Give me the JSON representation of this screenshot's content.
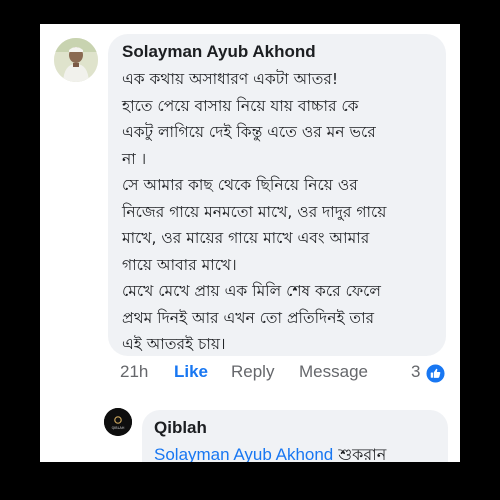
{
  "comment": {
    "author": "Solayman Ayub Akhond",
    "lines": [
      "এক কথায় অসাধারণ একটা আতর!",
      "হাতে পেয়ে বাসায় নিয়ে যায় বাচ্চার কে",
      "একটু লাগিয়ে দেই কিন্তু এতে ওর মন ভরে",
      "না ।",
      "সে আমার কাছ থেকে ছিনিয়ে নিয়ে ওর",
      "নিজের গায়ে মনমতো মাখে, ওর দাদুর গায়ে",
      "মাখে, ওর মায়ের গায়ে মাখে এবং আমার",
      "গায়ে আবার মাখে।",
      "মেখে মেখে প্রায় এক মিলি শেষ করে ফেলে",
      "প্রথম দিনই আর এখন তো প্রতিদিনই তার",
      "এই আতরই চায়।"
    ],
    "time": "21h",
    "like_label": "Like",
    "reply_label": "Reply",
    "message_label": "Message",
    "reaction_count": "3"
  },
  "reply": {
    "author": "Qiblah",
    "avatar_text": "QIBLAH",
    "mention": "Solayman Ayub Akhond",
    "text": " শুকরান"
  },
  "colors": {
    "accent": "#1877f2",
    "bubble": "#f0f2f5",
    "muted": "#65676b"
  }
}
